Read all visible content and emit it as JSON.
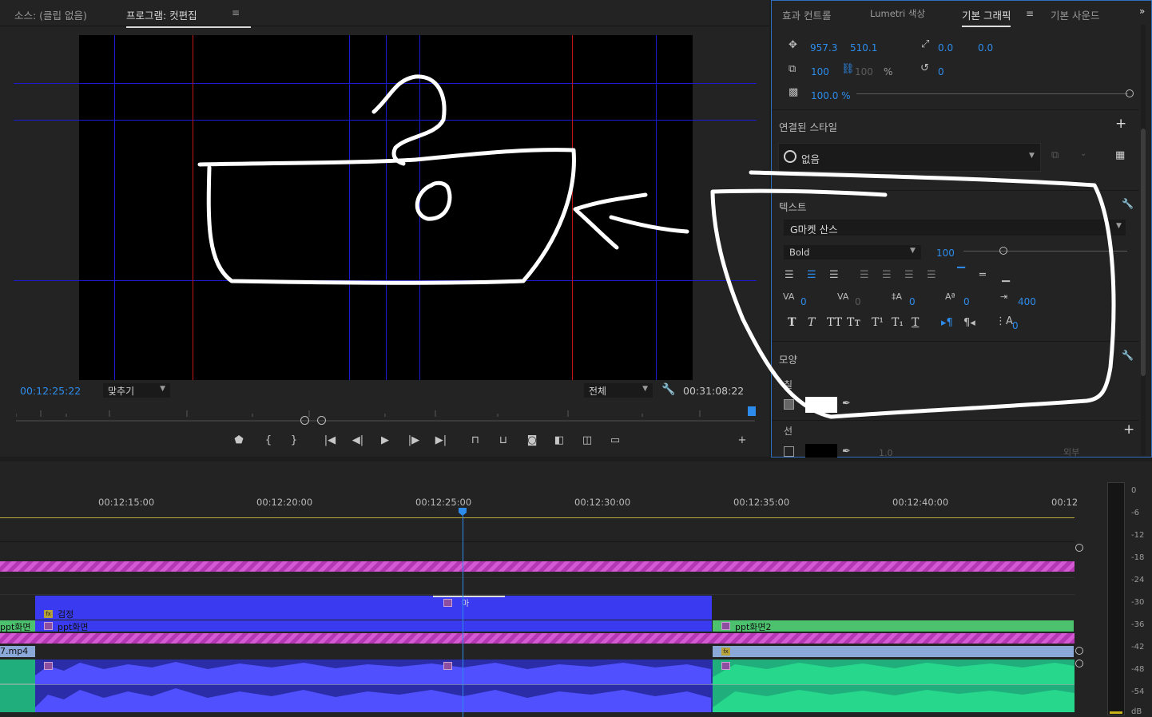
{
  "source_monitor": {
    "tab_label": "소스: (클립 없음)"
  },
  "program_monitor": {
    "tab_label": "프로그램: 컷편집",
    "current_timecode": "00:12:25:22",
    "fit_dropdown": "맞추기",
    "quality_dropdown": "전체",
    "duration": "00:31:08:22"
  },
  "essential_graphics": {
    "tabs": [
      "효과 컨트롤",
      "Lumetri 색상",
      "기본 그래픽",
      "기본 사운드"
    ],
    "active_tab": "기본 그래픽",
    "position": {
      "x": "957.3",
      "y": "510.1"
    },
    "anchor": {
      "x": "0.0",
      "y": "0.0"
    },
    "scale": "100",
    "scale_locked": "100",
    "scale_unit": "%",
    "rotation": "0",
    "opacity": "100.0 %",
    "linked_style_section": "연결된 스타일",
    "linked_style_value": "없음",
    "text_section": "텍스트",
    "font_name": "G마켓 산스",
    "font_weight": "Bold",
    "font_size": "100",
    "kerning": "0",
    "tracking": "0",
    "leading": "0",
    "baseline": "0",
    "tab_width": "400",
    "tsume": "0",
    "appearance_section": "모양",
    "fill_label": "칠",
    "fill_color": "#ffffff",
    "stroke_label": "선",
    "stroke_color": "#000000",
    "stroke_width": "1.0",
    "stroke_position": "외부"
  },
  "timeline": {
    "ruler_labels": [
      "00:12:15:00",
      "00:12:20:00",
      "00:12:25:00",
      "00:12:30:00",
      "00:12:35:00",
      "00:12:40:00",
      "00:12"
    ],
    "clips": {
      "black_video": "검정",
      "ppt_a": "ppt화면",
      "ppt_b": "ppt화면2",
      "ppt_left": "ppt화면",
      "mp4_left": "7.mp4",
      "small_title": "마"
    }
  },
  "audio_meter": {
    "db_labels": [
      "0",
      "-6",
      "-12",
      "-18",
      "-24",
      "-30",
      "-36",
      "-42",
      "-48",
      "-54",
      "dB"
    ]
  },
  "colors": {
    "accent_blue": "#2d8ceb",
    "clip_blue": "#3a3bf0",
    "clip_green": "#4cc26e",
    "audio_green": "#1fae7c",
    "hatch_pink": "#c846c8"
  }
}
